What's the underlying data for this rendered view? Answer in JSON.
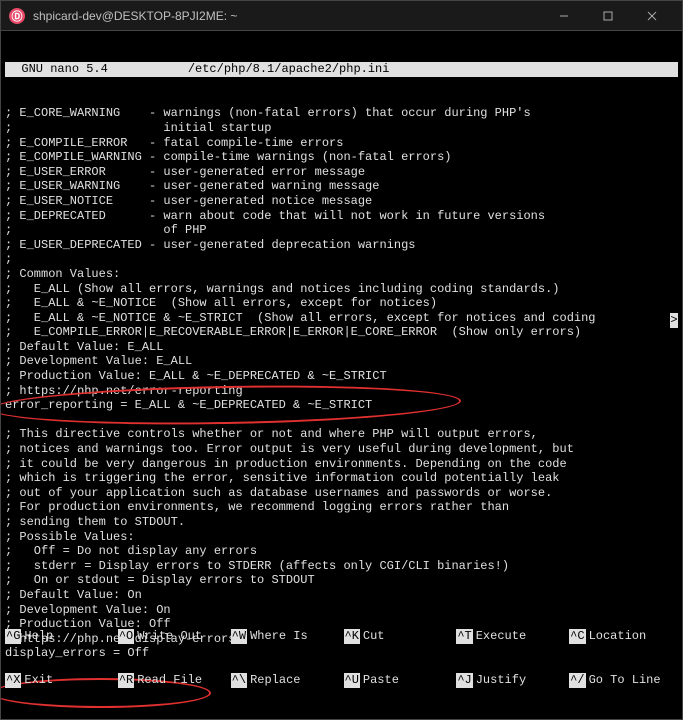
{
  "window": {
    "title": "shpicard-dev@DESKTOP-8PJI2ME: ~",
    "logo_glyph": "Ⓓ"
  },
  "nano": {
    "editor_name": "GNU nano 5.4",
    "file_path": "/etc/php/8.1/apache2/php.ini"
  },
  "lines": [
    "; E_CORE_WARNING    - warnings (non-fatal errors) that occur during PHP's",
    ";                     initial startup",
    "; E_COMPILE_ERROR   - fatal compile-time errors",
    "; E_COMPILE_WARNING - compile-time warnings (non-fatal errors)",
    "; E_USER_ERROR      - user-generated error message",
    "; E_USER_WARNING    - user-generated warning message",
    "; E_USER_NOTICE     - user-generated notice message",
    "; E_DEPRECATED      - warn about code that will not work in future versions",
    ";                     of PHP",
    "; E_USER_DEPRECATED - user-generated deprecation warnings",
    ";",
    "; Common Values:",
    ";   E_ALL (Show all errors, warnings and notices including coding standards.)",
    ";   E_ALL & ~E_NOTICE  (Show all errors, except for notices)",
    ";   E_ALL & ~E_NOTICE & ~E_STRICT  (Show all errors, except for notices and coding",
    ";   E_COMPILE_ERROR|E_RECOVERABLE_ERROR|E_ERROR|E_CORE_ERROR  (Show only errors)",
    "; Default Value: E_ALL",
    "; Development Value: E_ALL",
    "; Production Value: E_ALL & ~E_DEPRECATED & ~E_STRICT",
    "; https://php.net/error-reporting",
    "error_reporting = E_ALL & ~E_DEPRECATED & ~E_STRICT",
    "",
    "; This directive controls whether or not and where PHP will output errors,",
    "; notices and warnings too. Error output is very useful during development, but",
    "; it could be very dangerous in production environments. Depending on the code",
    "; which is triggering the error, sensitive information could potentially leak",
    "; out of your application such as database usernames and passwords or worse.",
    "; For production environments, we recommend logging errors rather than",
    "; sending them to STDOUT.",
    "; Possible Values:",
    ";   Off = Do not display any errors",
    ";   stderr = Display errors to STDERR (affects only CGI/CLI binaries!)",
    ";   On or stdout = Display errors to STDOUT",
    "; Default Value: On",
    "; Development Value: On",
    "; Production Value: Off",
    "; https://php.net/display-errors",
    "display_errors = Off",
    ""
  ],
  "shortcuts_row1": [
    {
      "key": "^G",
      "label": "Help"
    },
    {
      "key": "^O",
      "label": "Write Out"
    },
    {
      "key": "^W",
      "label": "Where Is"
    },
    {
      "key": "^K",
      "label": "Cut"
    },
    {
      "key": "^T",
      "label": "Execute"
    },
    {
      "key": "^C",
      "label": "Location"
    }
  ],
  "shortcuts_row2": [
    {
      "key": "^X",
      "label": "Exit"
    },
    {
      "key": "^R",
      "label": "Read File"
    },
    {
      "key": "^\\",
      "label": "Replace"
    },
    {
      "key": "^U",
      "label": "Paste"
    },
    {
      "key": "^J",
      "label": "Justify"
    },
    {
      "key": "^/",
      "label": "Go To Line"
    }
  ],
  "scroll_indicator": ">"
}
